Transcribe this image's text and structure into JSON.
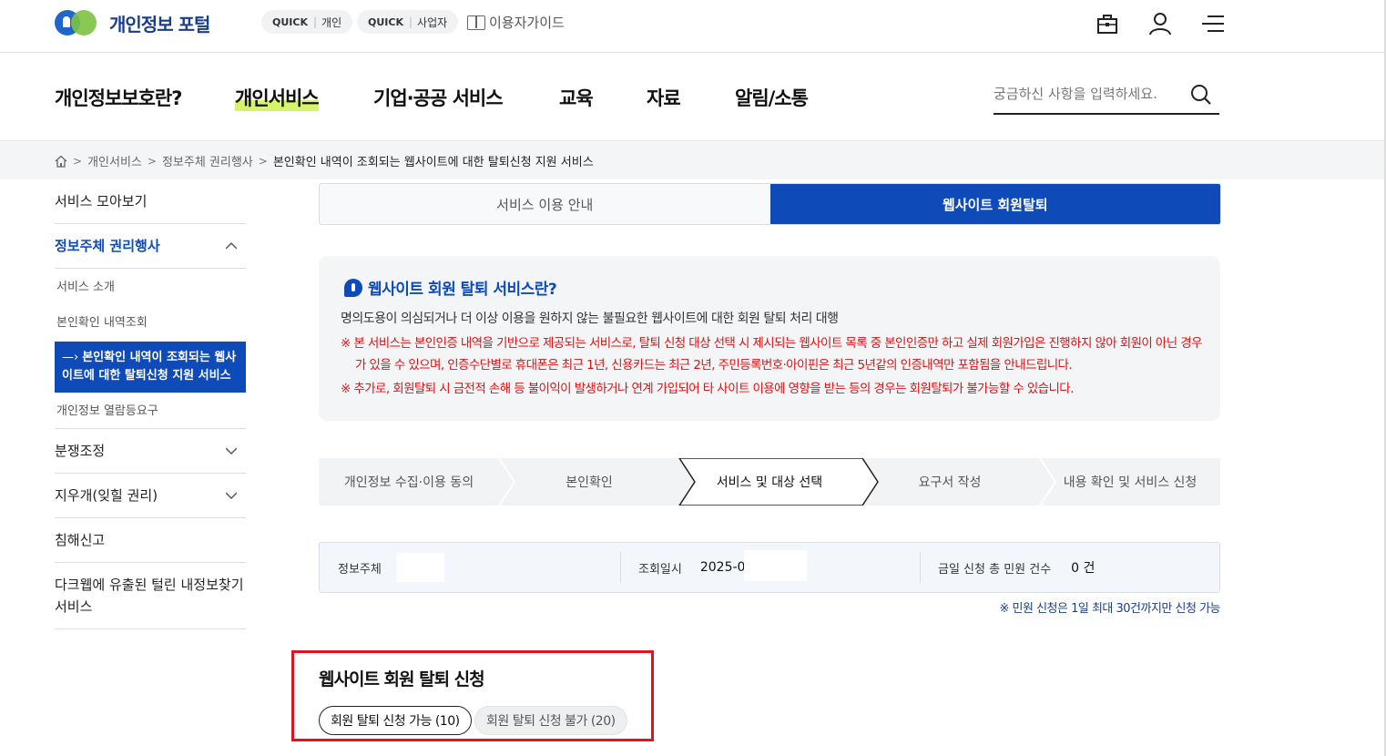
{
  "header": {
    "logo_text": "개인정보 포털",
    "quick_personal": {
      "tag": "QUICK",
      "label": "개인"
    },
    "quick_business": {
      "tag": "QUICK",
      "label": "사업자"
    },
    "user_guide": "이용자가이드",
    "icons": [
      "briefcase-icon",
      "user-icon",
      "menu-icon"
    ]
  },
  "nav": {
    "items": [
      "개인정보보호란?",
      "개인서비스",
      "기업·공공 서비스",
      "교육",
      "자료",
      "알림/소통"
    ],
    "active_index": 1,
    "search_placeholder": "궁금하신 사항을 입력하세요."
  },
  "breadcrumb": [
    "개인서비스",
    "정보주체 권리행사",
    "본인확인 내역이 조회되는 웹사이트에 대한 탈퇴신청 지원 서비스"
  ],
  "sidebar": {
    "items": [
      {
        "label": "서비스 모아보기"
      },
      {
        "label": "정보주체 권리행사",
        "expanded": true
      },
      {
        "label": "분쟁조정"
      },
      {
        "label": "지우개(잊힐 권리)"
      },
      {
        "label": "침해신고"
      },
      {
        "label": "다크웹에 유출된 털린 내정보찾기 서비스"
      }
    ],
    "sub_items": [
      "서비스 소개",
      "본인확인 내역조회",
      "본인확인 내역이 조회되는 웹사이트에 대한 탈퇴신청 지원 서비스",
      "개인정보 열람등요구"
    ],
    "active_sub_index": 2,
    "accent_color": "#0e4bb8"
  },
  "tabs": [
    {
      "label": "서비스 이용 안내",
      "active": false
    },
    {
      "label": "웹사이트 회원탈퇴",
      "active": true
    }
  ],
  "info": {
    "title": "웹사이트 회원 탈퇴 서비스란?",
    "desc": "명의도용이 의심되거나 더 이상 이용을 원하지 않는 불필요한 웹사이트에 대한 회원 탈퇴 처리 대행",
    "note1": "※ 본 서비스는 본인인증 내역을 기반으로 제공되는 서비스로, 탈퇴 신청 대상 선택 시 제시되는 웹사이트 목록 중 본인인증만 하고 실제 회원가입은 진행하지 않아 회원이 아닌 경우가 있을 수 있으며, 인증수단별로 휴대폰은 최근 1년, 신용카드는 최근 2년, 주민등록번호·아이핀은 최근 5년같의 인증내역만 포함됨을 안내드립니다.",
    "note2": "※ 추가로, 회원탈퇴 시 금전적 손해 등 불이익이 발생하거나 연계 가입되어 타 사이트 이용에 영향을 받는 등의 경우는 회원탈퇴가 불가능할 수 있습니다.",
    "note_color": "#dd1111"
  },
  "steps": [
    "개인정보 수집·이용 동의",
    "본인확인",
    "서비스 및 대상 선택",
    "요구서 작성",
    "내용 확인 및 서비스 신청"
  ],
  "current_step": 2,
  "status": {
    "subject_label": "정보주체",
    "subject_value": "",
    "time_label": "조회일시",
    "time_value": "2025-0",
    "count_label": "금일 신청 총 민원 건수",
    "count_value": "0 건"
  },
  "limit_note": "※ 민원 신청은 1일 최대 30건까지만 신청 가능",
  "withdraw": {
    "title": "웹사이트 회원 탈퇴 신청",
    "possible_label": "회원 탈퇴 신청 가능 (10)",
    "impossible_label": "회원 탈퇴 신청 불가 (20)",
    "highlight_color": "#e0141e"
  }
}
